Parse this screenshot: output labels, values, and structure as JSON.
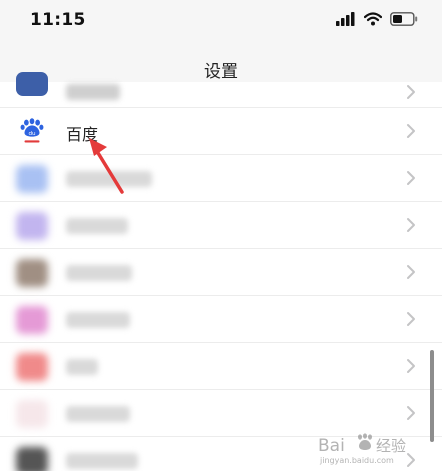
{
  "status_bar": {
    "time": "11:15"
  },
  "nav": {
    "title": "设置"
  },
  "rows": [
    {
      "label": "百度",
      "icon": "baidu-icon"
    }
  ],
  "watermark": {
    "brand": "Bai",
    "brand2": "经验",
    "url": "jingyan.baidu.com"
  },
  "colors": {
    "arrow": "#e43a3a",
    "baidu_blue": "#2d63e0",
    "baidu_red": "#e23b3b"
  }
}
